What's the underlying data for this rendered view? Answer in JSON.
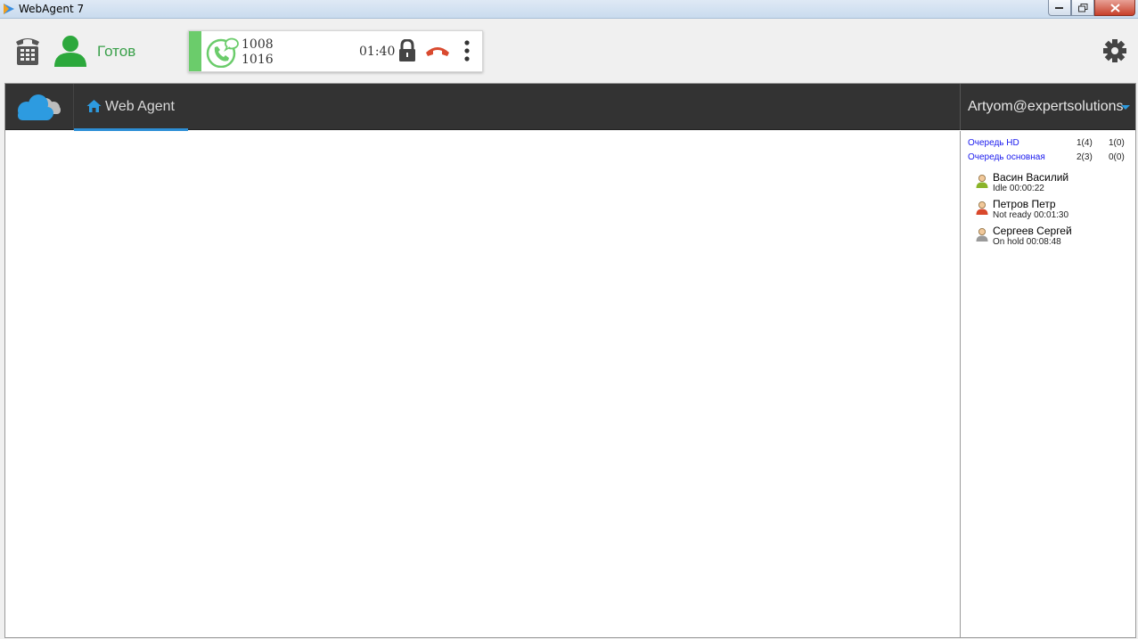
{
  "window": {
    "title": "WebAgent 7"
  },
  "toolbar": {
    "status_label": "Готов",
    "status_color": "#3aa04a"
  },
  "call": {
    "number_from": "1008",
    "number_to": "1016",
    "timer": "01:40",
    "stripe_color": "#6bcc6b",
    "hangup_color": "#d94a2f"
  },
  "nav": {
    "tab_label": "Web Agent",
    "user_label": "Artyom@expertsolutions",
    "accent_color": "#2d8fd6"
  },
  "queues": [
    {
      "name": "Очередь HD",
      "a": "1(4)",
      "b": "1(0)"
    },
    {
      "name": "Очередь основная",
      "a": "2(3)",
      "b": "0(0)"
    }
  ],
  "agents": [
    {
      "name": "Васин Василий",
      "status": "Idle 00:00:22",
      "color": "#8ab42a"
    },
    {
      "name": "Петров Петр",
      "status": "Not ready 00:01:30",
      "color": "#d9482b"
    },
    {
      "name": "Сергеев Сергей",
      "status": "On hold 00:08:48",
      "color": "#9a9a9a"
    }
  ]
}
